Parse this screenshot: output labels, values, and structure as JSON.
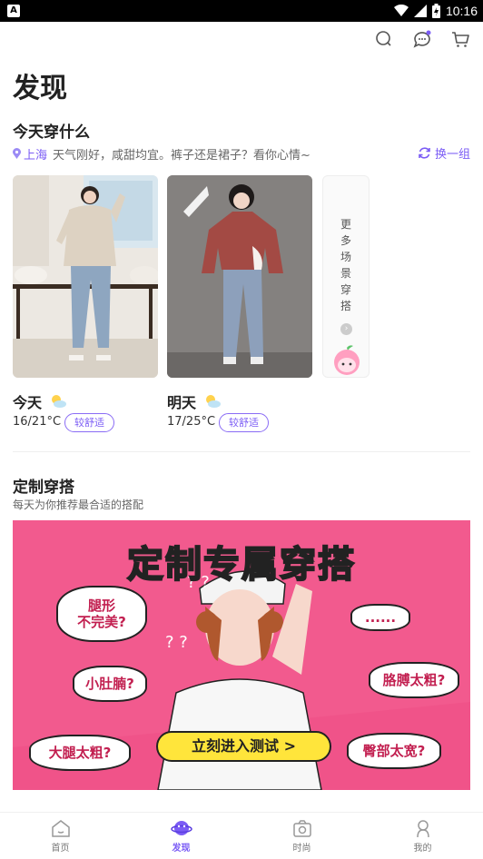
{
  "status_bar": {
    "app_badge": "A",
    "time": "10:16"
  },
  "page": {
    "title": "发现"
  },
  "today": {
    "section_title": "今天穿什么",
    "city": "上海",
    "weather_text": "天气刚好，咸甜均宜。裤子还是裙子？看你心情~",
    "refresh_label": "换一组",
    "more_label": "更多场景穿搭",
    "cards": [
      {
        "day": "今天",
        "temp": "16/21°C",
        "comfort": "较舒适"
      },
      {
        "day": "明天",
        "temp": "17/25°C",
        "comfort": "较舒适"
      }
    ]
  },
  "custom": {
    "section_title": "定制穿搭",
    "subtitle": "每天为你推荐最合适的搭配",
    "banner": {
      "headline": "定制专属穿搭",
      "bubbles": [
        "腿形\n不完美?",
        "小肚腩?",
        "大腿太粗?",
        "胳膊太粗?",
        "臀部太宽?",
        "......"
      ],
      "cta": "立刻进入测试 >"
    }
  },
  "tabs": [
    {
      "label": "首页",
      "icon": "home-icon",
      "active": false
    },
    {
      "label": "发现",
      "icon": "discover-planet-icon",
      "active": true
    },
    {
      "label": "时尚",
      "icon": "camera-icon",
      "active": false
    },
    {
      "label": "我的",
      "icon": "profile-icon",
      "active": false
    }
  ],
  "colors": {
    "accent": "#7b5cf5",
    "banner_bg": "#f25a8e",
    "cta_yellow": "#ffe53b"
  }
}
